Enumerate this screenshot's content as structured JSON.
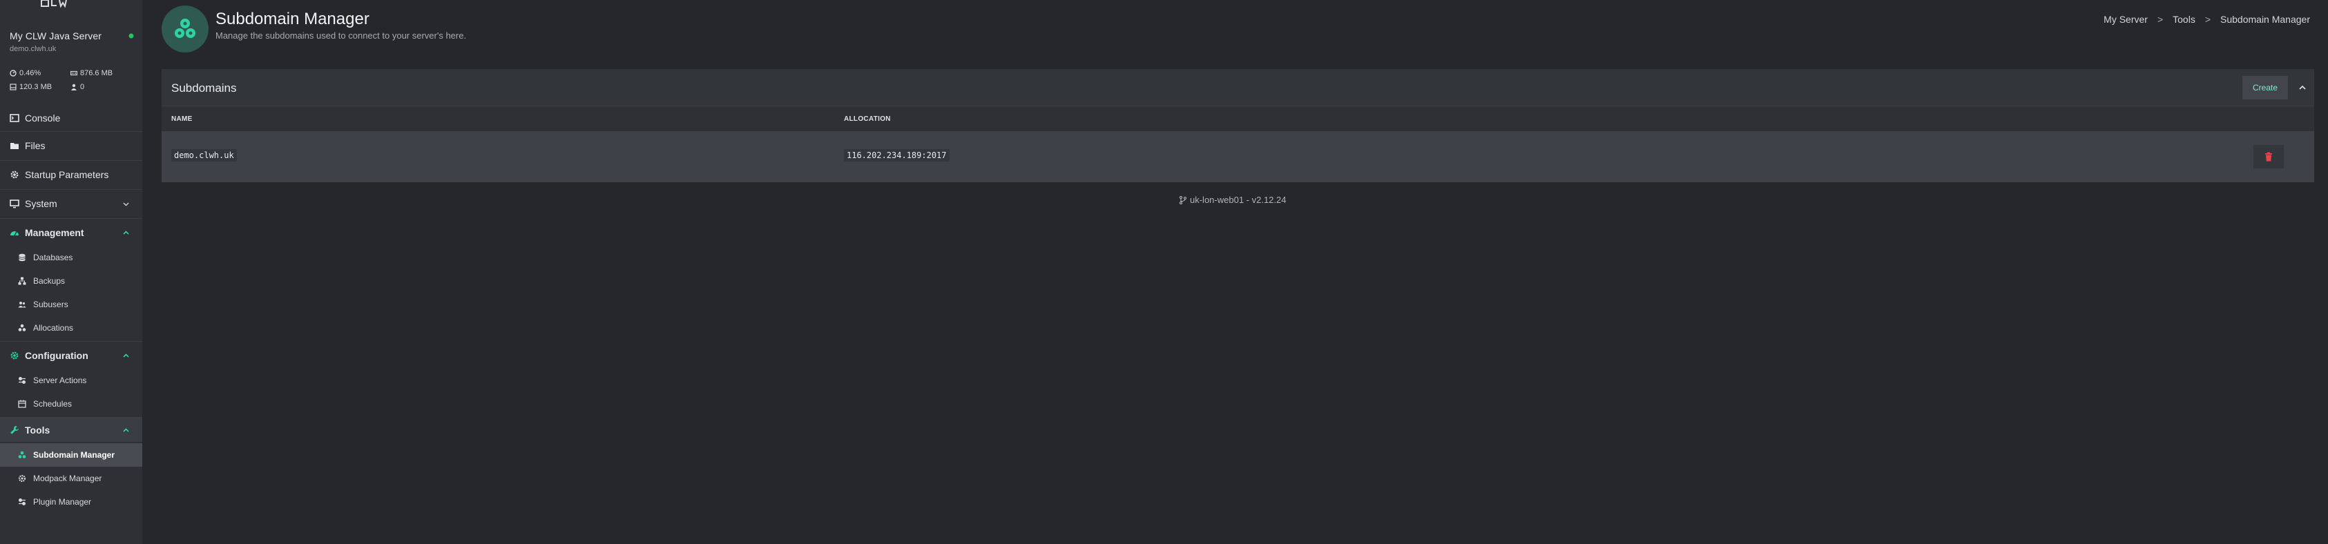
{
  "sidebar": {
    "server_name": "My CLW Java Server",
    "server_domain": "demo.clwh.uk",
    "stats": {
      "cpu": "0.46%",
      "memory": "876.6 MB",
      "disk": "120.3 MB",
      "players": "0"
    },
    "nav": {
      "console": "Console",
      "files": "Files",
      "startup": "Startup Parameters",
      "system": "System",
      "management": "Management",
      "databases": "Databases",
      "backups": "Backups",
      "subusers": "Subusers",
      "allocations": "Allocations",
      "configuration": "Configuration",
      "server_actions": "Server Actions",
      "schedules": "Schedules",
      "tools": "Tools",
      "subdomain_manager": "Subdomain Manager",
      "modpack_manager": "Modpack Manager",
      "plugin_manager": "Plugin Manager"
    }
  },
  "header": {
    "title": "Subdomain Manager",
    "subtitle": "Manage the subdomains used to connect to your server's here.",
    "breadcrumb": {
      "item1": "My Server",
      "item2": "Tools",
      "item3": "Subdomain Manager",
      "separator": ">"
    }
  },
  "card": {
    "title": "Subdomains",
    "create_label": "Create",
    "columns": {
      "name": "NAME",
      "allocation": "ALLOCATION"
    },
    "rows": [
      {
        "name": "demo.clwh.uk",
        "allocation": "116.202.234.189:2017"
      }
    ]
  },
  "footer": {
    "text": "uk-lon-web01 - v2.12.24"
  },
  "colors": {
    "accent": "#2fd4a5",
    "online": "#22c55e",
    "danger": "#ef4444",
    "background": "#25272b",
    "sidebar": "#2e3035"
  }
}
